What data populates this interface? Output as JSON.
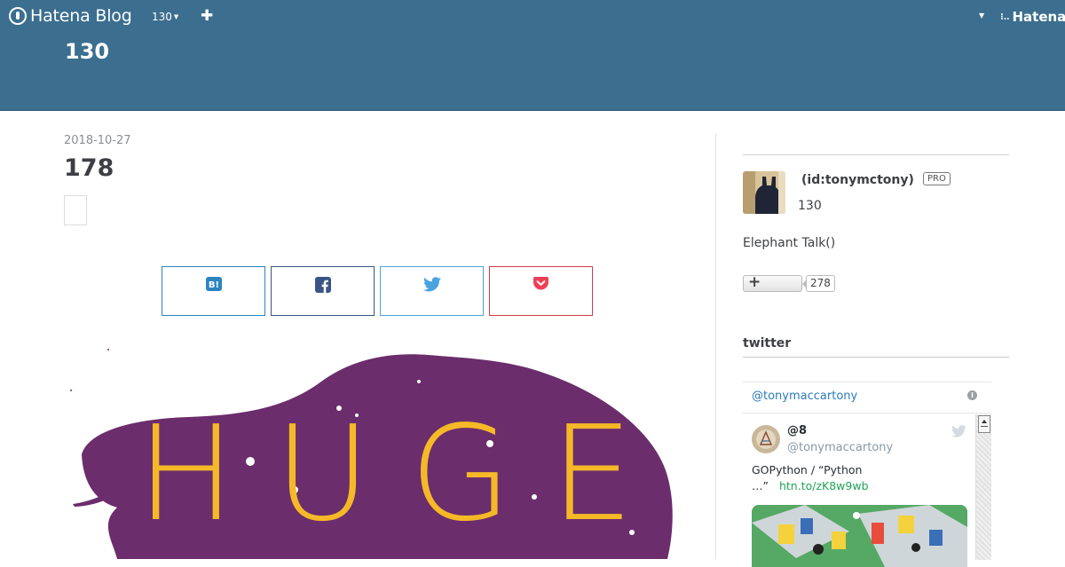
{
  "topbar": {
    "logo_text": "Hatena Blog",
    "blog_selector": "130",
    "add_icon": "plus-icon",
    "menu_icon": "chevron-down-icon",
    "hatena_text": "Hatena"
  },
  "header": {
    "blog_title": "130"
  },
  "entry": {
    "date": "2018-10-27",
    "title": "178",
    "share_buttons": [
      {
        "service": "hatena-bookmark",
        "icon": "hatena-bookmark-icon",
        "label": "B!"
      },
      {
        "service": "facebook",
        "icon": "facebook-icon"
      },
      {
        "service": "twitter",
        "icon": "twitter-icon"
      },
      {
        "service": "pocket",
        "icon": "pocket-icon"
      }
    ],
    "hero_text": "HUGE"
  },
  "sidebar": {
    "profile": {
      "id_label": "(id:tonymctony)",
      "pro_badge": "PRO",
      "blog_name": "130",
      "description": "Elephant Talk()",
      "follow_count": "278"
    },
    "twitter_module": {
      "title": "twitter",
      "widget_handle": "@tonymaccartony",
      "tweet": {
        "name": "@8",
        "screen_name": "@tonymaccartony",
        "text_line1": "GOPython / “Python",
        "text_line2": "…”",
        "link": "htn.to/zK8w9wb"
      }
    }
  },
  "colors": {
    "header_bg": "#3b6e8f",
    "hero_blob": "#6b2d6b",
    "hero_text": "#f5b928",
    "tweet_link": "#20a35b",
    "twitter_handle": "#2b7bb9"
  }
}
